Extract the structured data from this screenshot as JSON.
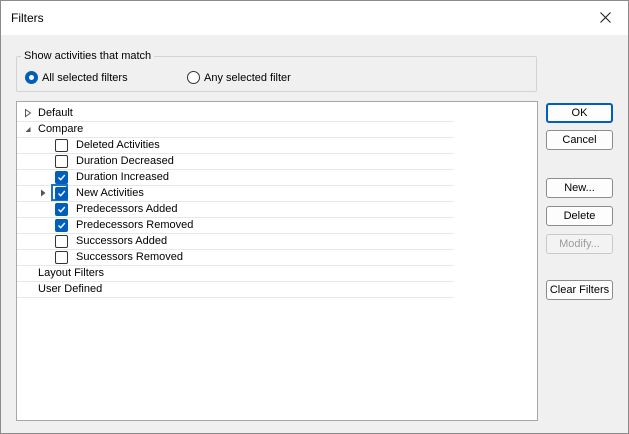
{
  "dialog": {
    "title": "Filters"
  },
  "match_group": {
    "legend": "Show activities that match",
    "options": [
      {
        "label": "All selected filters",
        "selected": true
      },
      {
        "label": "Any selected filter",
        "selected": false
      }
    ]
  },
  "tree": {
    "default_label": "Default",
    "compare_label": "Compare",
    "compare_items": [
      {
        "label": "Deleted Activities",
        "checked": false
      },
      {
        "label": "Duration Decreased",
        "checked": false
      },
      {
        "label": "Duration Increased",
        "checked": true
      },
      {
        "label": "New Activities",
        "checked": true
      },
      {
        "label": "Predecessors Added",
        "checked": true
      },
      {
        "label": "Predecessors Removed",
        "checked": true
      },
      {
        "label": "Successors Added",
        "checked": false
      },
      {
        "label": "Successors Removed",
        "checked": false
      }
    ],
    "layout_filters_label": "Layout Filters",
    "user_defined_label": "User Defined"
  },
  "buttons": {
    "ok": "OK",
    "cancel": "Cancel",
    "new": "New...",
    "delete": "Delete",
    "modify": "Modify...",
    "clear_filters": "Clear Filters"
  },
  "colors": {
    "accent": "#005fb8",
    "focus": "#1e6fd0"
  },
  "icons": {
    "close": "close-icon",
    "collapsed": "triangle-right-icon",
    "expanded": "triangle-down-icon",
    "check": "checkmark-icon"
  }
}
